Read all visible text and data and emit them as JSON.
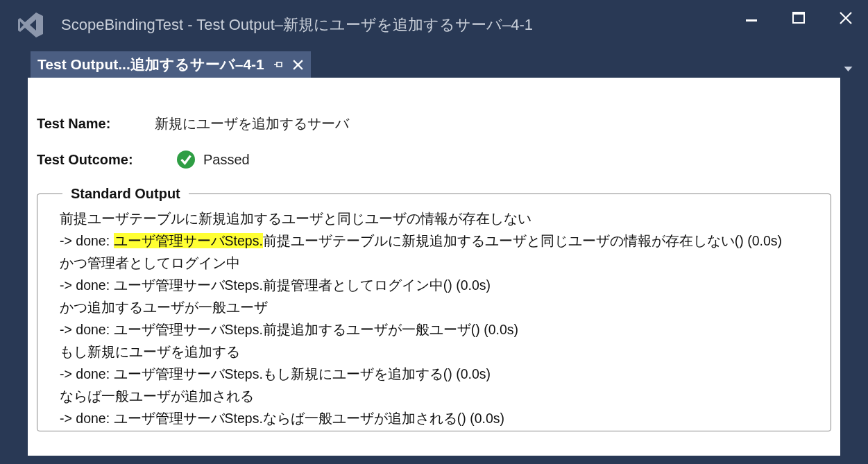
{
  "window": {
    "title": "ScopeBindingTest - Test Output–新規にユーザを追加するサーバ–4-1"
  },
  "tabs": [
    {
      "label": "Test Output...追加するサーバ–4-1",
      "selected": true,
      "pinned": true
    }
  ],
  "details": [
    {
      "label": "Test Name:",
      "value": "新規にユーザを追加するサーバ",
      "kind": "text"
    },
    {
      "label": "Test Outcome:",
      "value": "Passed",
      "kind": "outcome"
    }
  ],
  "standard_output": {
    "title": "Standard Output",
    "lines": [
      {
        "parts": [
          {
            "text": "前提ユーザテーブルに新規追加するユーザと同じユーザの情報が存在しない",
            "highlighted": false
          }
        ]
      },
      {
        "parts": [
          {
            "text": "-> done: ",
            "highlighted": false
          },
          {
            "text": "ユーザ管理サーバSteps.",
            "highlighted": true
          },
          {
            "text": "前提ユーザテーブルに新規追加するユーザと同じユーザの情報が存在しない() (0.0s)",
            "highlighted": false
          }
        ]
      },
      {
        "parts": [
          {
            "text": "かつ管理者としてログイン中",
            "highlighted": false
          }
        ]
      },
      {
        "parts": [
          {
            "text": "-> done: ユーザ管理サーバSteps.前提管理者としてログイン中() (0.0s)",
            "highlighted": false
          }
        ]
      },
      {
        "parts": [
          {
            "text": "かつ追加するユーザが一般ユーザ",
            "highlighted": false
          }
        ]
      },
      {
        "parts": [
          {
            "text": "-> done: ユーザ管理サーバSteps.前提追加するユーザが一般ユーザ() (0.0s)",
            "highlighted": false
          }
        ]
      },
      {
        "parts": [
          {
            "text": "もし新規にユーザを追加する",
            "highlighted": false
          }
        ]
      },
      {
        "parts": [
          {
            "text": "-> done: ユーザ管理サーバSteps.もし新規にユーザを追加する() (0.0s)",
            "highlighted": false
          }
        ]
      },
      {
        "parts": [
          {
            "text": "ならば一般ユーザが追加される",
            "highlighted": false
          }
        ]
      },
      {
        "parts": [
          {
            "text": "-> done: ユーザ管理サーバSteps.ならば一般ユーザが追加される() (0.0s)",
            "highlighted": false
          }
        ]
      }
    ]
  }
}
